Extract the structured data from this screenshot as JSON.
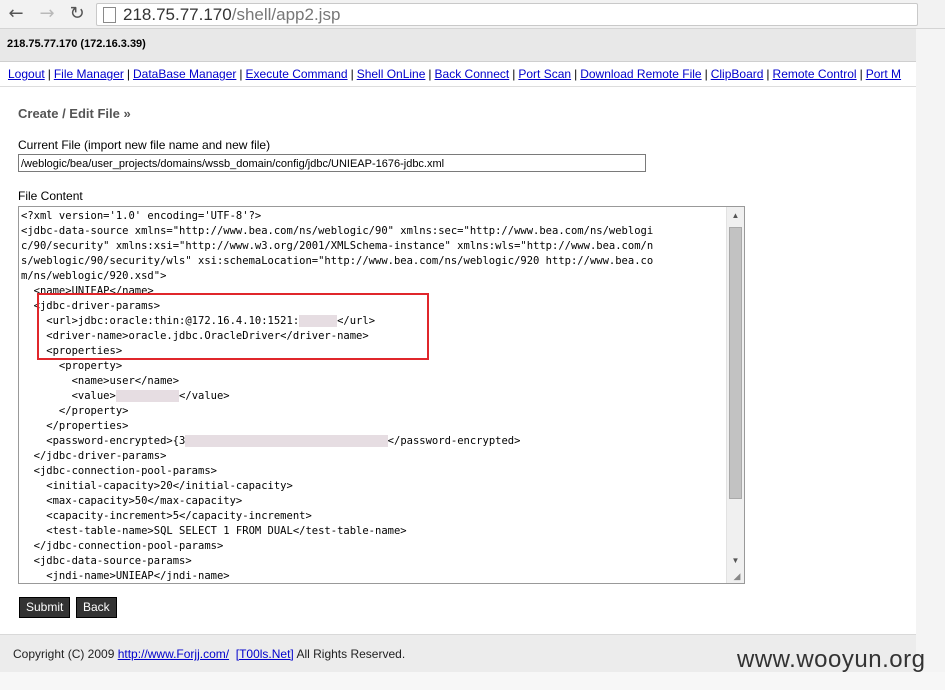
{
  "browser": {
    "back_icon": "arrow-left-icon",
    "forward_icon": "arrow-right-icon",
    "reload_icon": "reload-icon",
    "url_host": "218.75.77.170",
    "url_path": "/shell/app2.jsp"
  },
  "host_info": "218.75.77.170 (172.16.3.39)",
  "menu": [
    "Logout",
    "File Manager",
    "DataBase Manager",
    "Execute Command",
    "Shell OnLine",
    "Back Connect",
    "Port Scan",
    "Download Remote File",
    "ClipBoard",
    "Remote Control",
    "Port M"
  ],
  "page": {
    "title": "Create / Edit File »",
    "current_file_label": "Current File (import new file name and new file)",
    "current_file_value": "/weblogic/bea/user_projects/domains/wssb_domain/config/jdbc/UNIEAP-1676-jdbc.xml",
    "file_content_label": "File Content",
    "file_content": [
      "<?xml version='1.0' encoding='UTF-8'?>",
      "<jdbc-data-source xmlns=\"http://www.bea.com/ns/weblogic/90\" xmlns:sec=\"http://www.bea.com/ns/weblogi",
      "c/90/security\" xmlns:xsi=\"http://www.w3.org/2001/XMLSchema-instance\" xmlns:wls=\"http://www.bea.com/n",
      "s/weblogic/90/security/wls\" xsi:schemaLocation=\"http://www.bea.com/ns/weblogic/920 http://www.bea.co",
      "m/ns/weblogic/920.xsd\">",
      "  <name>UNIEAP</name>",
      "  <jdbc-driver-params>",
      "    <url>jdbc:oracle:thin:@172.16.4.10:1521:[[blur:      ]]</url>",
      "    <driver-name>oracle.jdbc.OracleDriver</driver-name>",
      "    <properties>",
      "      <property>",
      "        <name>user</name>",
      "        <value>[[blur:          ]]</value>",
      "      </property>",
      "    </properties>",
      "    <password-encrypted>{3[[blur:                                ]]</password-encrypted>",
      "  </jdbc-driver-params>",
      "  <jdbc-connection-pool-params>",
      "    <initial-capacity>20</initial-capacity>",
      "    <max-capacity>50</max-capacity>",
      "    <capacity-increment>5</capacity-increment>",
      "    <test-table-name>SQL SELECT 1 FROM DUAL</test-table-name>",
      "  </jdbc-connection-pool-params>",
      "  <jdbc-data-source-params>",
      "    <jndi-name>UNIEAP</jndi-name>"
    ],
    "submit_label": "Submit",
    "back_label": "Back"
  },
  "footer": {
    "prefix": "Copyright (C) 2009 ",
    "link1": "http://www.Forjj.com/",
    "link2": "[T00ls.Net]",
    "suffix": " All Rights Reserved."
  },
  "watermark": "www.wooyun.org",
  "colors": {
    "link": "#0000cc",
    "highlight_box": "#e0262b",
    "button_bg": "#333333"
  }
}
